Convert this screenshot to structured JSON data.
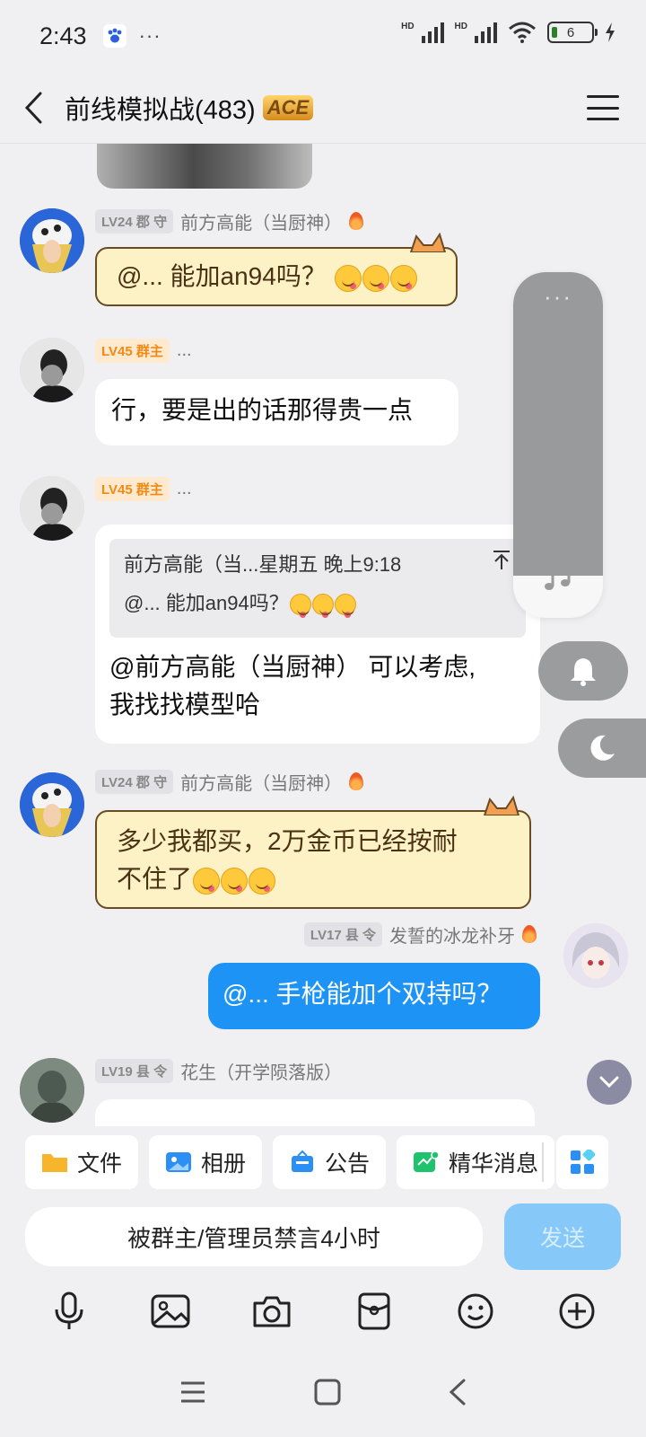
{
  "status_bar": {
    "time": "2:43",
    "more": "···",
    "battery": "6",
    "network": "HD"
  },
  "header": {
    "title": "前线模拟战(483)",
    "badge": "ACE"
  },
  "messages": [
    {
      "level": "LV24 郡 守",
      "name": "前方高能（当厨神）",
      "text": "@... 能加an94吗？"
    },
    {
      "level": "LV45 群主",
      "name": "...",
      "text": "行，要是出的话那得贵一点"
    },
    {
      "level": "LV45 群主",
      "name": "...",
      "quote": {
        "author": "前方高能（当...",
        "time": "星期五 晚上9:18",
        "text": "@... 能加an94吗？"
      },
      "text_line1": "@前方高能（当厨神） 可以考虑,",
      "text_line2": "我找找模型哈"
    },
    {
      "level": "LV24 郡 守",
      "name": "前方高能（当厨神）",
      "text_line1": "多少我都买，2万金币已经按耐",
      "text_line2": "不住了"
    },
    {
      "level": "LV17 县 令",
      "name": "发誓的冰龙补牙",
      "text": "@... 手枪能加个双持吗？"
    },
    {
      "level": "LV19 县 令",
      "name": "花生（开学陨落版）"
    }
  ],
  "floating": {
    "dots": "···"
  },
  "toolbar": {
    "items": [
      "文件",
      "相册",
      "公告",
      "精华消息"
    ]
  },
  "input": {
    "muted_text": "被群主/管理员禁言4小时",
    "send": "发送"
  },
  "colors": {
    "accent": "#1c93f5",
    "cat_bubble": "#fdf1c6",
    "owner_badge": "#f08a14"
  }
}
